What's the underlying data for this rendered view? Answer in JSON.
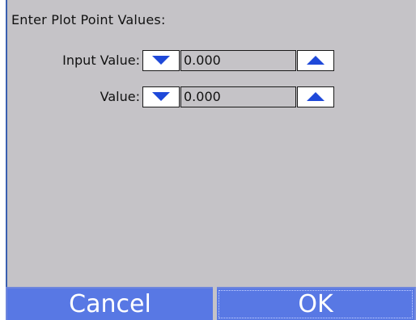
{
  "dialog": {
    "prompt": "Enter Plot Point Values:"
  },
  "fields": [
    {
      "label": "Input Value:",
      "value": "0.000"
    },
    {
      "label": "Value:",
      "value": "0.000"
    }
  ],
  "icons": {
    "decrement": "triangle-down-icon",
    "increment": "triangle-up-icon"
  },
  "softkeys": {
    "cancel": "Cancel",
    "ok": "OK"
  },
  "colors": {
    "background": "#c5c3c7",
    "accent": "#3a5fb0",
    "softkey": "#5878e4",
    "arrow": "#1f49d9"
  }
}
